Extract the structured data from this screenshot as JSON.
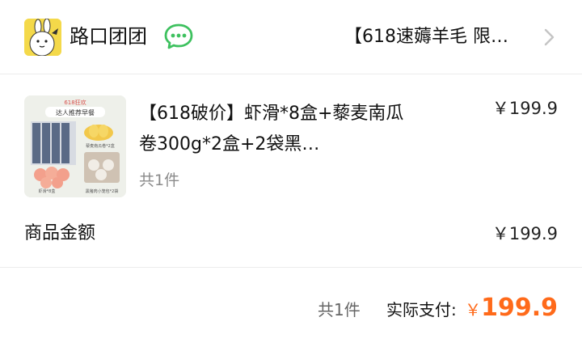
{
  "shop": {
    "name": "路口团团",
    "promo_text": "【618速薅羊毛 限…"
  },
  "item": {
    "title": "【618破价】虾滑*8盒+藜麦南瓜卷300g*2盒+2袋黑…",
    "price": "￥199.9",
    "quantity": "共1件",
    "thumbnail_text": {
      "badge": "618狂欢",
      "banner": "达人推荐早餐",
      "label_top_right": "藜麦南瓜卷*2盒",
      "label_bottom_left": "虾滑*8盒",
      "label_bottom_right": "黑猪肉小笼包*2袋"
    }
  },
  "summary": {
    "subtotal_label": "商品金额",
    "subtotal_value": "￥199.9"
  },
  "footer": {
    "quantity": "共1件",
    "paid_label": "实际支付:",
    "currency": "￥",
    "amount": "199.9"
  },
  "colors": {
    "accent": "#ff6a1a",
    "chat_icon": "#3ec15f",
    "avatar_bg": "#f4d94a"
  }
}
